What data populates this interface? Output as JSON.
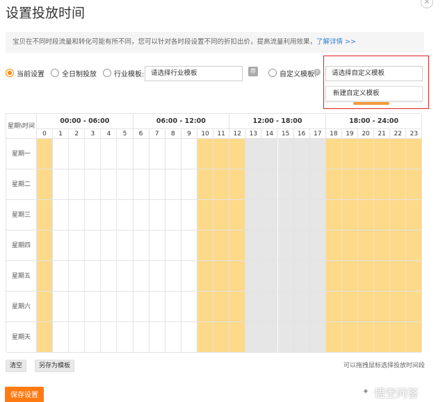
{
  "dialog": {
    "title": "设置投放时间",
    "close_icon": "close-icon"
  },
  "info": {
    "text": "宝贝在不同时段流量和转化可能有所不同，您可以针对各时段设置不同的折扣出价，提高流量利用效果，",
    "link": "了解详情 >>"
  },
  "options": {
    "current": "当前设置",
    "all_day": "全日制投放",
    "industry": "行业模板:",
    "industry_placeholder": "请选择行业模板",
    "recommend": "荐",
    "custom": "自定义模板:",
    "custom_help": "?",
    "custom_placeholder": "请选择自定义模板",
    "new_custom": "新建自定义模板",
    "selected": "current"
  },
  "schedule": {
    "corner": "星期\\时间",
    "ranges": [
      "00:00 - 06:00",
      "06:00 - 12:00",
      "12:00 - 18:00",
      "18:00 - 24:00"
    ],
    "hours": [
      "0",
      "1",
      "2",
      "3",
      "4",
      "5",
      "6",
      "7",
      "8",
      "9",
      "10",
      "11",
      "12",
      "13",
      "14",
      "15",
      "16",
      "17",
      "18",
      "19",
      "20",
      "21",
      "22",
      "23"
    ],
    "days": [
      "星期一",
      "星期二",
      "星期三",
      "星期四",
      "星期五",
      "星期六",
      "星期天"
    ],
    "hour_states": [
      "on",
      "off",
      "off",
      "off",
      "off",
      "off",
      "off",
      "off",
      "off",
      "off",
      "on",
      "on",
      "on",
      "gray",
      "gray",
      "gray",
      "gray",
      "gray",
      "on",
      "on",
      "on",
      "on",
      "on",
      "on"
    ],
    "colors": {
      "on": "#fdd98a",
      "gray": "#e6e6e6",
      "off": "#ffffff"
    }
  },
  "footer": {
    "clear": "清空",
    "save_template": "另存为模板",
    "hint": "可以拖拽鼠标选择投放时间段",
    "save": "保存设置"
  },
  "watermark": {
    "text": "悟空问答",
    "icon": "chat-bubble-icon"
  }
}
